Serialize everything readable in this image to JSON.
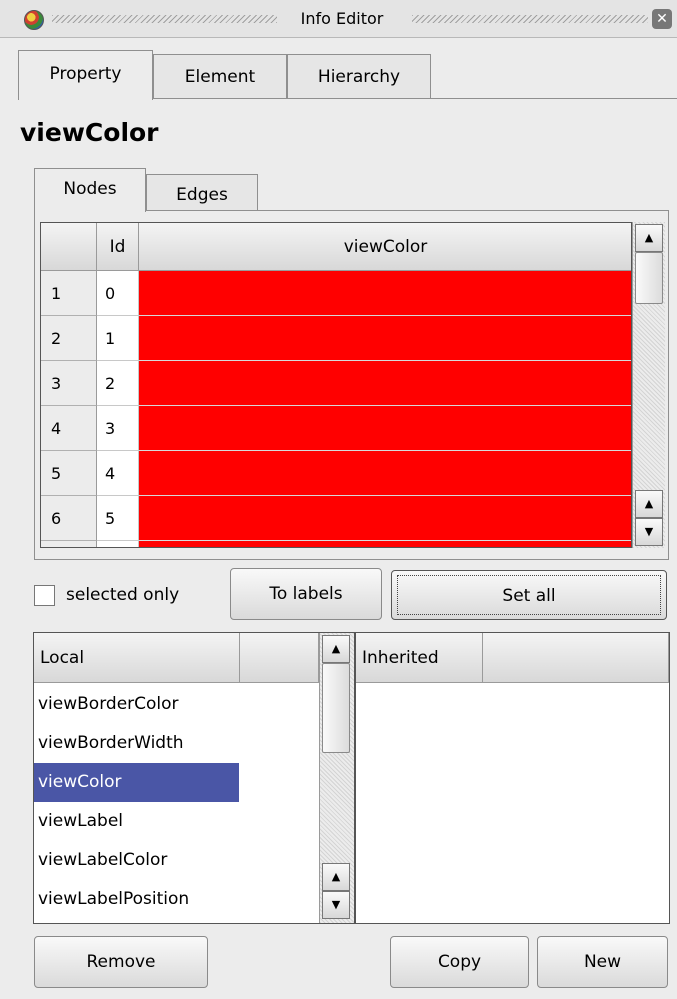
{
  "window": {
    "title": "Info Editor"
  },
  "tabs": [
    "Property",
    "Element",
    "Hierarchy"
  ],
  "property_name": "viewColor",
  "subtabs": [
    "Nodes",
    "Edges"
  ],
  "table": {
    "headers": [
      "",
      "Id",
      "viewColor"
    ],
    "rows": [
      {
        "num": "1",
        "id": "0",
        "color": "#ff0000"
      },
      {
        "num": "2",
        "id": "1",
        "color": "#ff0000"
      },
      {
        "num": "3",
        "id": "2",
        "color": "#ff0000"
      },
      {
        "num": "4",
        "id": "3",
        "color": "#ff0000"
      },
      {
        "num": "5",
        "id": "4",
        "color": "#ff0000"
      },
      {
        "num": "6",
        "id": "5",
        "color": "#ff0000"
      }
    ]
  },
  "controls": {
    "selected_only_label": "selected only",
    "to_labels": "To labels",
    "set_all": "Set all"
  },
  "local_list": {
    "header": "Local",
    "items": [
      "viewBorderColor",
      "viewBorderWidth",
      "viewColor",
      "viewLabel",
      "viewLabelColor",
      "viewLabelPosition"
    ],
    "selected": "viewColor"
  },
  "inherited_list": {
    "header": "Inherited"
  },
  "buttons": {
    "remove": "Remove",
    "copy": "Copy",
    "new": "New"
  },
  "colors": {
    "selection": "#4a56a6",
    "cell_color": "#ff0000"
  }
}
